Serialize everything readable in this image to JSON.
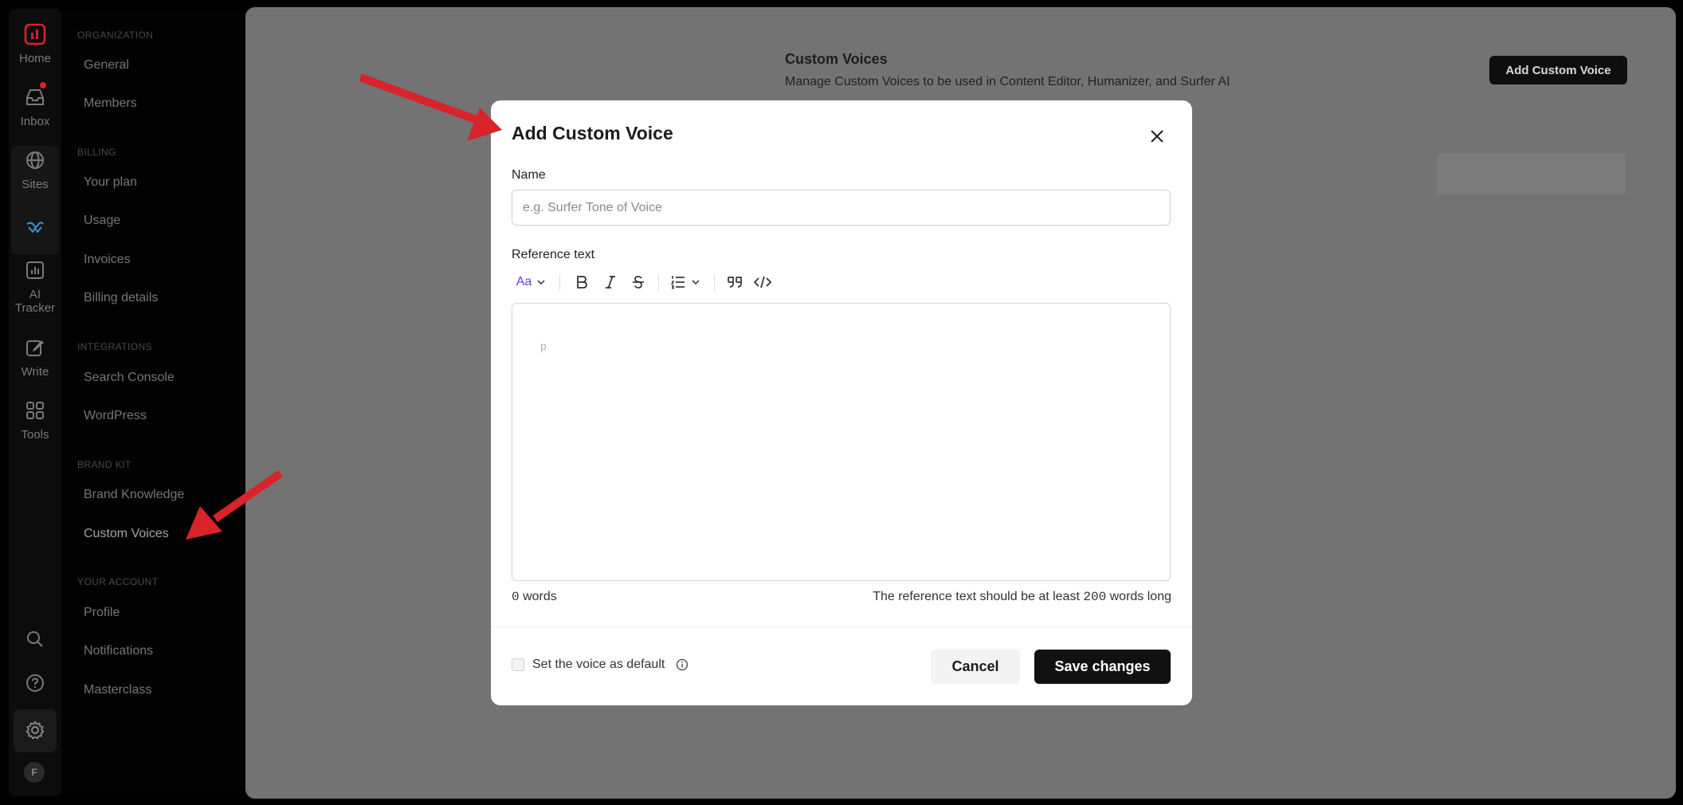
{
  "rail": {
    "items": [
      {
        "label": "Home",
        "icon": "logo-icon"
      },
      {
        "label": "Inbox",
        "icon": "inbox-icon"
      },
      {
        "label": "Sites",
        "icon": "globe-icon"
      },
      {
        "label": "AI Tracker",
        "icon": "chart-icon"
      },
      {
        "label": "Write",
        "icon": "write-icon"
      },
      {
        "label": "Tools",
        "icon": "grid-icon"
      }
    ],
    "avatar_initial": "F"
  },
  "sidebar": {
    "sections": [
      {
        "title": "ORGANIZATION",
        "items": [
          "General",
          "Members"
        ]
      },
      {
        "title": "BILLING",
        "items": [
          "Your plan",
          "Usage",
          "Invoices",
          "Billing details"
        ]
      },
      {
        "title": "INTEGRATIONS",
        "items": [
          "Search Console",
          "WordPress"
        ]
      },
      {
        "title": "BRAND KIT",
        "items": [
          "Brand Knowledge",
          "Custom Voices"
        ]
      },
      {
        "title": "YOUR ACCOUNT",
        "items": [
          "Profile",
          "Notifications",
          "Masterclass"
        ]
      }
    ],
    "active": "Custom Voices"
  },
  "main": {
    "title": "Custom Voices",
    "subtitle": "Manage Custom Voices to be used in Content Editor, Humanizer, and Surfer AI",
    "add_button": "Add Custom Voice"
  },
  "modal": {
    "title": "Add Custom Voice",
    "name_label": "Name",
    "name_placeholder": "e.g. Surfer Tone of Voice",
    "name_value": "",
    "reference_label": "Reference text",
    "toolbar": {
      "format_label": "Aa"
    },
    "editor_placeholder": "p",
    "word_count": "0",
    "word_count_suffix": "words",
    "hint_prefix": "The reference text should be at least",
    "hint_number": "200",
    "hint_suffix": "words long",
    "default_checkbox_label": "Set the voice as default",
    "cancel": "Cancel",
    "save": "Save changes"
  },
  "colors": {
    "accent_purple": "#6d3fd2",
    "annotation_red": "#d8232a",
    "primary_button": "#111111"
  }
}
